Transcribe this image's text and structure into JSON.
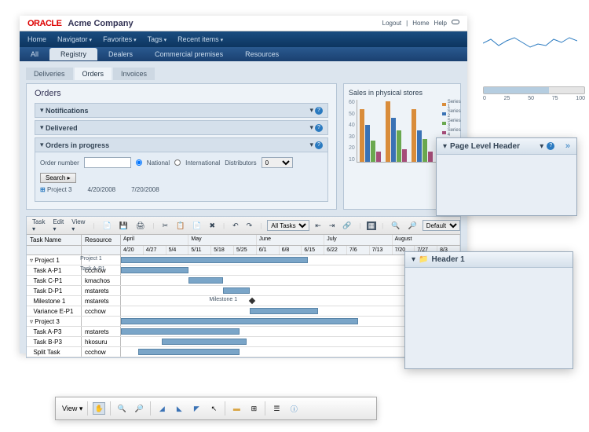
{
  "header": {
    "logo": "ORACLE",
    "company": "Acme Company",
    "links": [
      "Logout",
      "Home",
      "Help"
    ]
  },
  "nav": [
    "Home",
    "Navigator",
    "Favorites",
    "Tags",
    "Recent items"
  ],
  "subnav": {
    "items": [
      "All",
      "Registry",
      "Dealers",
      "Commercial premises",
      "Resources"
    ],
    "active": 1
  },
  "inner_tabs": {
    "items": [
      "Deliveries",
      "Orders",
      "Invoices"
    ],
    "active": 1
  },
  "orders": {
    "title": "Orders",
    "accordions": [
      {
        "label": "Notifications"
      },
      {
        "label": "Delivered"
      },
      {
        "label": "Orders in progress",
        "open": true
      }
    ],
    "form": {
      "order_label": "Order number",
      "national": "National",
      "international": "International",
      "dist_label": "Distributors",
      "dist_value": "0",
      "search_btn": "Search"
    },
    "result": {
      "name": "Project 3",
      "d1": "4/20/2008",
      "d2": "7/20/2008"
    }
  },
  "sales": {
    "title": "Sales in physical stores",
    "legend": [
      "Series 1",
      "Series 2",
      "Series 3",
      "Series 4"
    ],
    "colors": [
      "#d98c3a",
      "#3a72b5",
      "#6aa84f",
      "#a64d79"
    ]
  },
  "chart_data": {
    "type": "bar",
    "title": "Sales in physical stores",
    "ylim": [
      0,
      60
    ],
    "yticks": [
      10,
      20,
      30,
      40,
      50,
      60
    ],
    "series": [
      {
        "name": "Series 1",
        "values": [
          50,
          58,
          50
        ]
      },
      {
        "name": "Series 2",
        "values": [
          35,
          42,
          30
        ]
      },
      {
        "name": "Series 3",
        "values": [
          20,
          30,
          22
        ]
      },
      {
        "name": "Series 4",
        "values": [
          10,
          12,
          10
        ]
      }
    ]
  },
  "gantt": {
    "toolbar": {
      "task": "Task",
      "edit": "Edit",
      "view": "View",
      "all_tasks": "All Tasks",
      "default": "Default"
    },
    "cols": [
      "Task Name",
      "Resource"
    ],
    "months": [
      "April",
      "May",
      "June",
      "July",
      "August"
    ],
    "dates": [
      "4/20",
      "4/27",
      "5/4",
      "5/11",
      "5/18",
      "5/25",
      "6/1",
      "6/8",
      "6/15",
      "6/22",
      "7/6",
      "7/13",
      "7/20",
      "7/27",
      "8/3"
    ],
    "rows": [
      {
        "name": "Project 1",
        "res": "",
        "label": "Project 1",
        "bar": [
          0,
          55
        ]
      },
      {
        "name": "Task A-P1",
        "res": "ccchow",
        "label": "Task A-P1",
        "bar": [
          0,
          20
        ]
      },
      {
        "name": "Task C-P1",
        "res": "kmachos",
        "bar": [
          20,
          10
        ]
      },
      {
        "name": "Task D-P1",
        "res": "mstarets",
        "bar": [
          30,
          8
        ]
      },
      {
        "name": "Milestone 1",
        "res": "mstarets",
        "label": "Milestone 1",
        "diamond": 38
      },
      {
        "name": "Variance E-P1",
        "res": "ccchow",
        "bar": [
          38,
          20
        ]
      },
      {
        "name": "Project 3",
        "res": "",
        "bar": [
          0,
          70
        ]
      },
      {
        "name": "Task A-P3",
        "res": "mstarets",
        "bar": [
          0,
          35
        ]
      },
      {
        "name": "Task B-P3",
        "res": "hkosuru",
        "bar": [
          12,
          25
        ]
      },
      {
        "name": "Split Task",
        "res": "ccchow",
        "bar": [
          5,
          30
        ]
      }
    ]
  },
  "bottom_toolbar": {
    "view": "View"
  },
  "float1": {
    "title": "Page Level Header"
  },
  "float2": {
    "title": "Header 1"
  },
  "slider": {
    "ticks": [
      "0",
      "25",
      "50",
      "75",
      "100"
    ],
    "value": 65
  }
}
